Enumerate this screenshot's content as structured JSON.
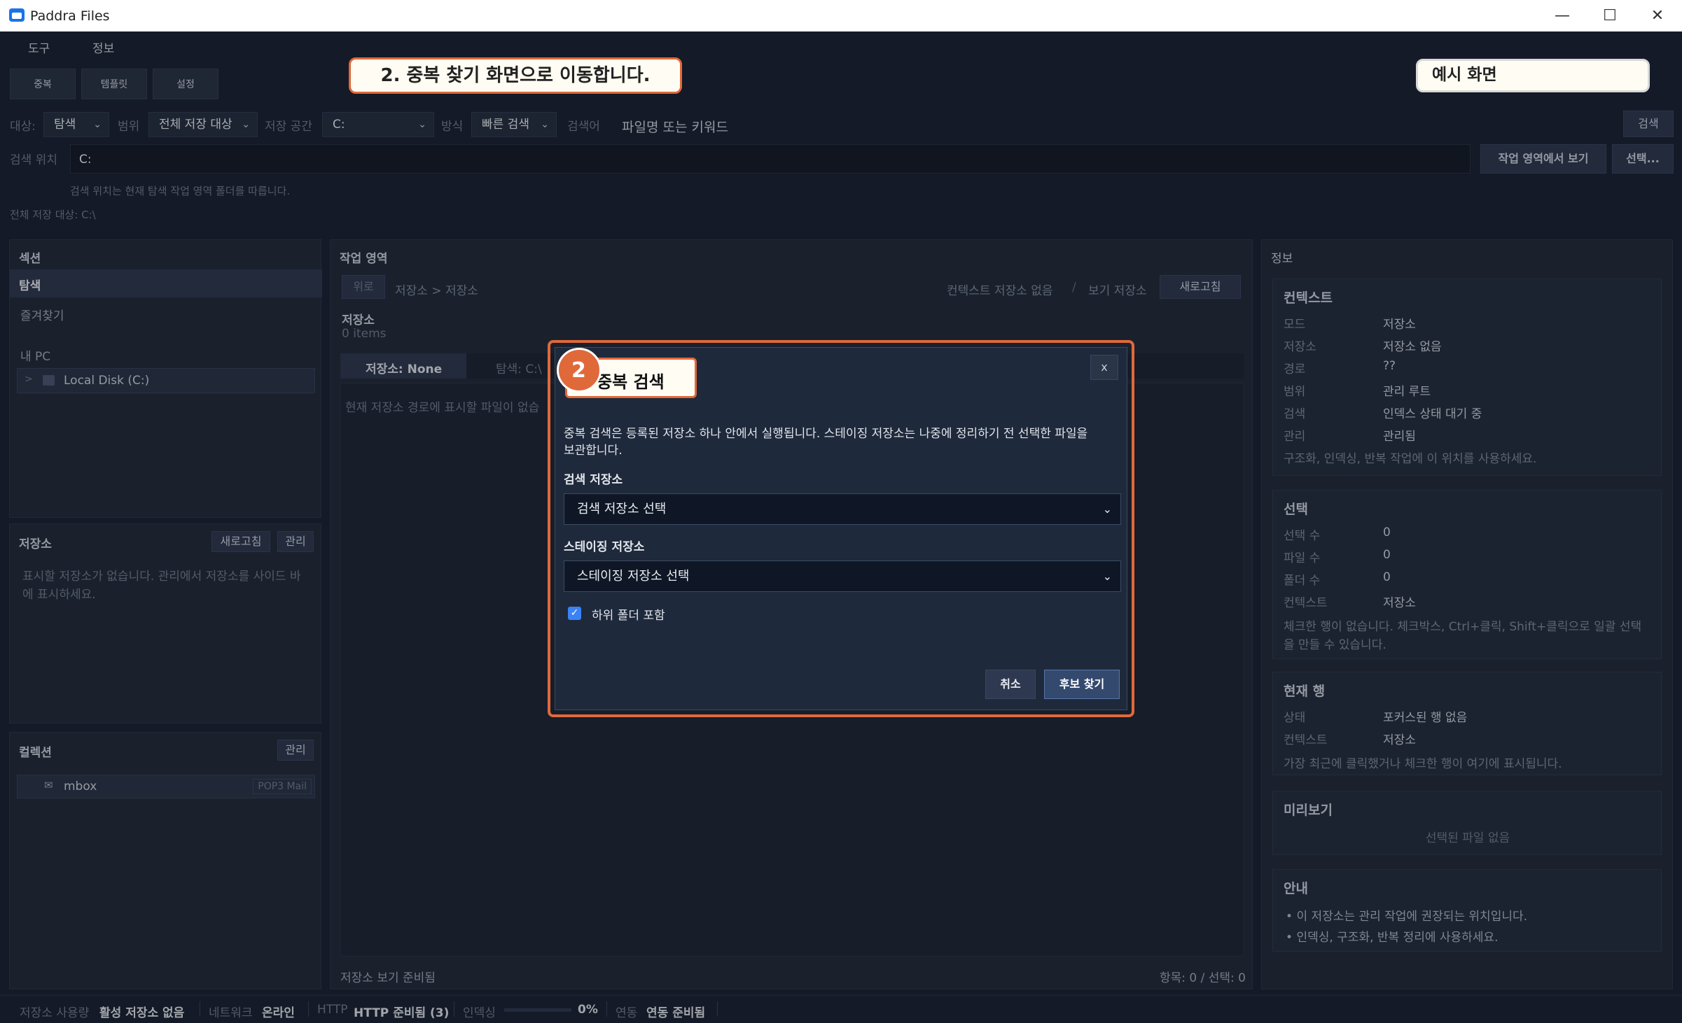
{
  "window": {
    "title": "Paddra Files"
  },
  "menu": [
    "도구",
    "정보"
  ],
  "toolbar": {
    "dup": "중복",
    "template": "템플릿",
    "settings": "설정"
  },
  "callouts": {
    "step": "2. 중복 찾기 화면으로 이동합니다.",
    "example": "예시 화면"
  },
  "filter": {
    "target_label": "대상:",
    "target_value": "탐색",
    "scope_label": "범위",
    "scope_value": "전체 저장 대상",
    "storage_label": "저장 공간",
    "storage_value": "C:",
    "method_label": "방식",
    "method_value": "빠른 검색",
    "query_label": "검색어",
    "query_placeholder": "파일명 또는 키워드",
    "search_button": "검색"
  },
  "location": {
    "label": "검색 위치",
    "value": "C:",
    "view_button": "작업 영역에서 보기",
    "select_button": "선택...",
    "hint": "검색 위치는 현재 탐색 작업 영역 폴더를 따릅니다.",
    "all_storage": "전체 저장 대상: C:\\"
  },
  "sections": {
    "title": "섹션",
    "explore": "탐색",
    "favorites": "즐겨찾기",
    "my_pc": "내 PC",
    "local_disk": "Local Disk (C:)"
  },
  "storage_panel": {
    "title": "저장소",
    "refresh": "새로고침",
    "manage": "관리",
    "empty": "표시할 저장소가 없습니다. 관리에서 저장소를 사이드 바에 표시하세요."
  },
  "collection_panel": {
    "title": "컬렉션",
    "manage": "관리",
    "item": "mbox",
    "badge": "POP3 Mail"
  },
  "workspace": {
    "title": "작업 영역",
    "up": "위로",
    "breadcrumb": "저장소 > 저장소",
    "context_storage": "컨텍스트 저장소 없음",
    "sep": "/",
    "view_storage": "보기 저장소",
    "refresh": "새로고침",
    "heading": "저장소",
    "count": "0 items",
    "tab_active": "저장소: None",
    "tab_other": "탐색: C:\\",
    "empty": "현재 저장소 경로에 표시할 파일이 없습",
    "status_left": "저장소 보기 준비됨",
    "status_right": "항목: 0 / 선택: 0"
  },
  "info": {
    "title": "정보",
    "context": {
      "title": "컨텍스트",
      "rows": [
        [
          "모드",
          "저장소"
        ],
        [
          "저장소",
          "저장소 없음"
        ],
        [
          "경로",
          "??"
        ],
        [
          "범위",
          "관리 루트"
        ],
        [
          "검색",
          "인덱스 상태 대기 중"
        ],
        [
          "관리",
          "관리됨"
        ]
      ],
      "note": "구조화, 인덱싱, 반복 작업에 이 위치를 사용하세요."
    },
    "selection": {
      "title": "선택",
      "rows": [
        [
          "선택 수",
          "0"
        ],
        [
          "파일 수",
          "0"
        ],
        [
          "폴더 수",
          "0"
        ],
        [
          "컨텍스트",
          "저장소"
        ]
      ],
      "note1": "체크한 행이 없습니다. 체크박스, Ctrl+클릭, Shift+클릭으로 일괄 선택",
      "note2": "을 만들 수 있습니다."
    },
    "current_row": {
      "title": "현재 행",
      "rows": [
        [
          "상태",
          "포커스된 행 없음"
        ],
        [
          "컨텍스트",
          "저장소"
        ]
      ],
      "note": "가장 최근에 클릭했거나 체크한 행이 여기에 표시됩니다."
    },
    "preview": {
      "title": "미리보기",
      "empty": "선택된 파일 없음"
    },
    "guide": {
      "title": "안내",
      "items": [
        "이 저장소는 관리 작업에 권장되는 위치입니다.",
        "인덱싱, 구조화, 반복 정리에 사용하세요."
      ]
    }
  },
  "modal": {
    "title": "중복 검색",
    "badge": "2",
    "close": "x",
    "desc1": "중복 검색은 등록된 저장소 하나 안에서 실행됩니다. 스테이징 저장소는 나중에 정리하기 전 선택한 파일을",
    "desc2": "보관합니다.",
    "search_label": "검색 저장소",
    "search_value": "검색 저장소 선택",
    "staging_label": "스테이징 저장소",
    "staging_value": "스테이징 저장소 선택",
    "include_sub": "하위 폴더 포함",
    "cancel": "취소",
    "find": "후보 찾기"
  },
  "status": {
    "usage_k": "저장소 사용량",
    "usage_v": "활성 저장소 없음",
    "net_k": "네트워크",
    "net_v": "온라인",
    "http_k": "HTTP",
    "http_v": "HTTP 준비됨 (3)",
    "index_k": "인덱싱",
    "index_progress": 0,
    "index_v": "0%",
    "sync_k": "연동",
    "sync_v": "연동 준비됨"
  },
  "colors": {
    "accent": "#e0693a",
    "primary_btn": "#34496e",
    "bg": "#1b2334"
  }
}
